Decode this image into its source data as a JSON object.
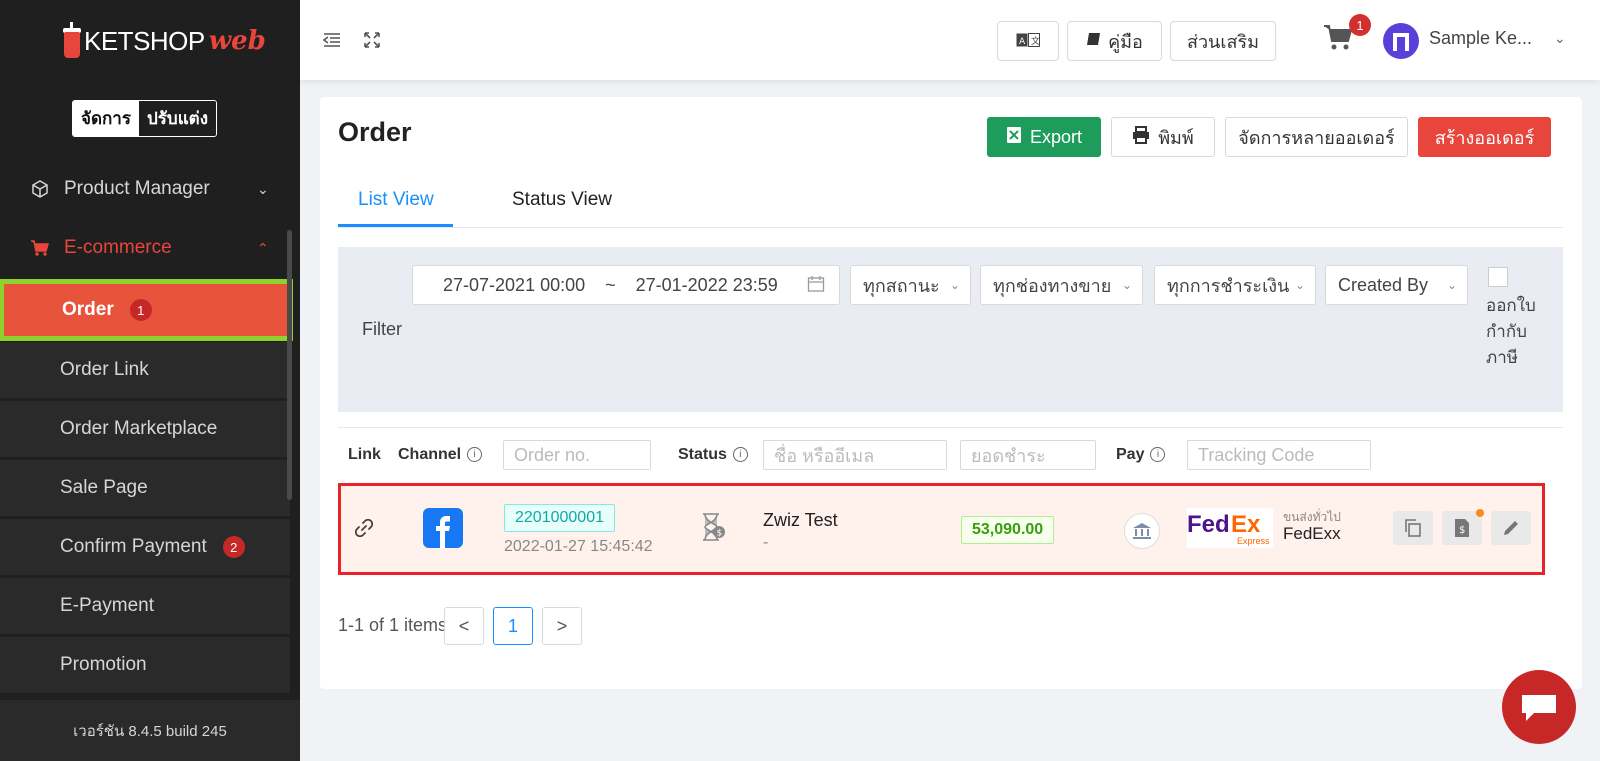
{
  "brand": {
    "name": "KETSHOP",
    "suffix": "web"
  },
  "mode": {
    "manage": "จัดการ",
    "customize": "ปรับแต่ง"
  },
  "sidebar": {
    "groups": [
      {
        "label": "Product Manager",
        "icon": "box-icon"
      },
      {
        "label": "E-commerce",
        "icon": "cart-icon"
      }
    ],
    "items": [
      {
        "label": "Order",
        "badge": "1"
      },
      {
        "label": "Order Link"
      },
      {
        "label": "Order Marketplace"
      },
      {
        "label": "Sale Page"
      },
      {
        "label": "Confirm Payment",
        "badge": "2"
      },
      {
        "label": "E-Payment"
      },
      {
        "label": "Promotion"
      }
    ],
    "version": "เวอร์ชัน 8.4.5 build 245"
  },
  "header": {
    "manual": "คู่มือ",
    "addons": "ส่วนเสริม",
    "cart_badge": "1",
    "user": "Sample Ke..."
  },
  "page": {
    "title": "Order",
    "actions": {
      "export": "Export",
      "print": "พิมพ์",
      "bulk": "จัดการหลายออเดอร์",
      "create": "สร้างออเดอร์"
    },
    "tabs": [
      "List View",
      "Status View"
    ]
  },
  "filter": {
    "label": "Filter",
    "date_from": "27-07-2021 00:00",
    "date_sep": "~",
    "date_to": "27-01-2022 23:59",
    "status": "ทุกสถานะ",
    "channel": "ทุกช่องทางขาย",
    "payment": "ทุกการชำระเงิน",
    "created_by": "Created By",
    "tax_invoice": "ออกใบกำกับภาษี"
  },
  "table": {
    "headers": {
      "link": "Link",
      "channel": "Channel",
      "status": "Status",
      "pay": "Pay"
    },
    "placeholders": {
      "order_no": "Order no.",
      "name": "ชื่อ หรืออีเมล",
      "amount": "ยอดชำระ",
      "tracking": "Tracking Code"
    },
    "rows": [
      {
        "order_no": "2201000001",
        "date": "2022-01-27 15:45:42",
        "customer": "Zwiz Test",
        "customer_sub": "-",
        "amount": "53,090.00",
        "ship_type": "ขนส่งทั่วไป",
        "carrier": "FedExx"
      }
    ]
  },
  "pagination": {
    "summary": "1-1 of 1 items",
    "current": "1",
    "prev": "<",
    "next": ">"
  },
  "colors": {
    "accent": "#e8453c",
    "link": "#1890ff",
    "export": "#1e9c5c",
    "highlight": "#8fd12d"
  }
}
